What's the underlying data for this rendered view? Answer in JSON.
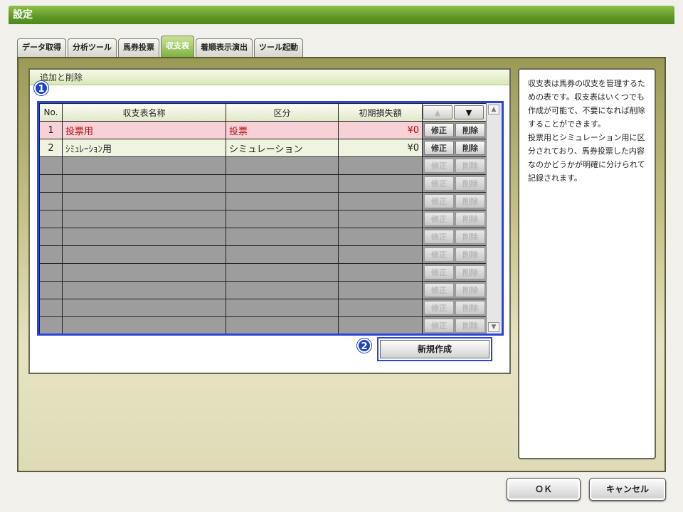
{
  "window": {
    "title": "設定"
  },
  "tabs": [
    {
      "label": "データ取得",
      "active": false
    },
    {
      "label": "分析ツール",
      "active": false
    },
    {
      "label": "馬券投票",
      "active": false
    },
    {
      "label": "収支表",
      "active": true
    },
    {
      "label": "着順表示演出",
      "active": false
    },
    {
      "label": "ツール起動",
      "active": false
    }
  ],
  "section": {
    "title": "追加と削除"
  },
  "badges": {
    "one": "1",
    "two": "2"
  },
  "table": {
    "headers": {
      "no": "No.",
      "name": "収支表名称",
      "category": "区分",
      "initial": "初期損失額"
    },
    "sort": {
      "up_icon": "triangle-up-icon",
      "down_icon": "triangle-down-icon",
      "up": "▲",
      "down": "▼"
    },
    "rows": [
      {
        "no": "1",
        "name": "投票用",
        "category": "投票",
        "initial": "¥0",
        "edit": "修正",
        "delete": "削除"
      },
      {
        "no": "2",
        "name": "ｼﾐｭﾚｰｼｮﾝ用",
        "category": "シミュレーション",
        "initial": "¥0",
        "edit": "修正",
        "delete": "削除"
      }
    ],
    "empty_row_count": 10,
    "empty_edit": "修正",
    "empty_delete": "削除",
    "scroll": {
      "up": "▲",
      "down": "▼"
    }
  },
  "new_button": {
    "label": "新規作成"
  },
  "help": {
    "text": "収支表は馬券の収支を管理するための表です。収支表はいくつでも作成が可能で、不要になれば削除することができます。\n投票用とシミュレーション用に区分されており、馬券投票した内容なのかどうかが明確に分けられて記録されます。"
  },
  "footer": {
    "ok": "ＯＫ",
    "cancel": "キャンセル"
  },
  "colors": {
    "accent_green": "#5e9826",
    "highlight_blue": "#2a45d8",
    "row_pink": "#f7d1d5",
    "row_green": "#eef4df"
  }
}
